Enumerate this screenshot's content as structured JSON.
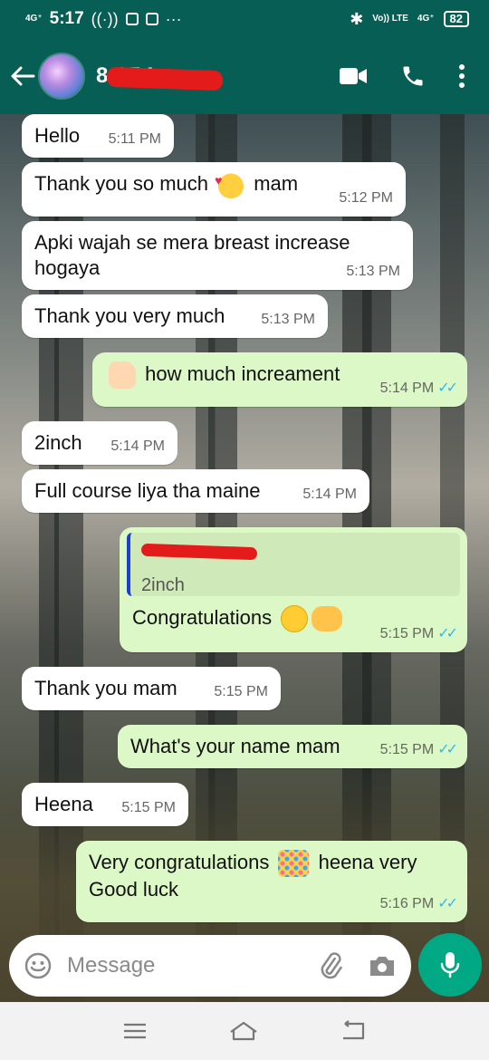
{
  "status": {
    "time": "5:17",
    "network_left": "4G⁺",
    "network_right": "4G⁺",
    "volte": "Vo)) LTE",
    "battery": "82"
  },
  "header": {
    "contact_visible": "8 254"
  },
  "messages": [
    {
      "dir": "in",
      "text": "Hello",
      "time": "5:11 PM"
    },
    {
      "dir": "in",
      "text_a": "Thank you so much",
      "text_b": "mam",
      "emoji": "smiling-face-with-hearts",
      "time": "5:12 PM"
    },
    {
      "dir": "in",
      "text": "Apki wajah se mera breast increase hogaya",
      "time": "5:13 PM"
    },
    {
      "dir": "in",
      "text": "Thank you very much",
      "time": "5:13 PM"
    },
    {
      "dir": "out",
      "emoji": "thumbs-up",
      "text": "how much increament",
      "time": "5:14 PM"
    },
    {
      "dir": "in",
      "text": "2inch",
      "time": "5:14 PM"
    },
    {
      "dir": "in",
      "text": "Full course liya tha maine",
      "time": "5:14 PM"
    },
    {
      "dir": "out",
      "quote_text": "2inch",
      "text": "Congratulations",
      "emoji": "smile-handshake",
      "time": "5:15 PM"
    },
    {
      "dir": "in",
      "text": "Thank you mam",
      "time": "5:15 PM"
    },
    {
      "dir": "out",
      "text": "What's your name mam",
      "time": "5:15 PM"
    },
    {
      "dir": "in",
      "text": "Heena",
      "time": "5:15 PM"
    },
    {
      "dir": "out",
      "text_a": "Very congratulations",
      "text_b": "heena very Good luck",
      "emoji": "confetti",
      "time": "5:16 PM"
    }
  ],
  "input": {
    "placeholder": "Message"
  }
}
